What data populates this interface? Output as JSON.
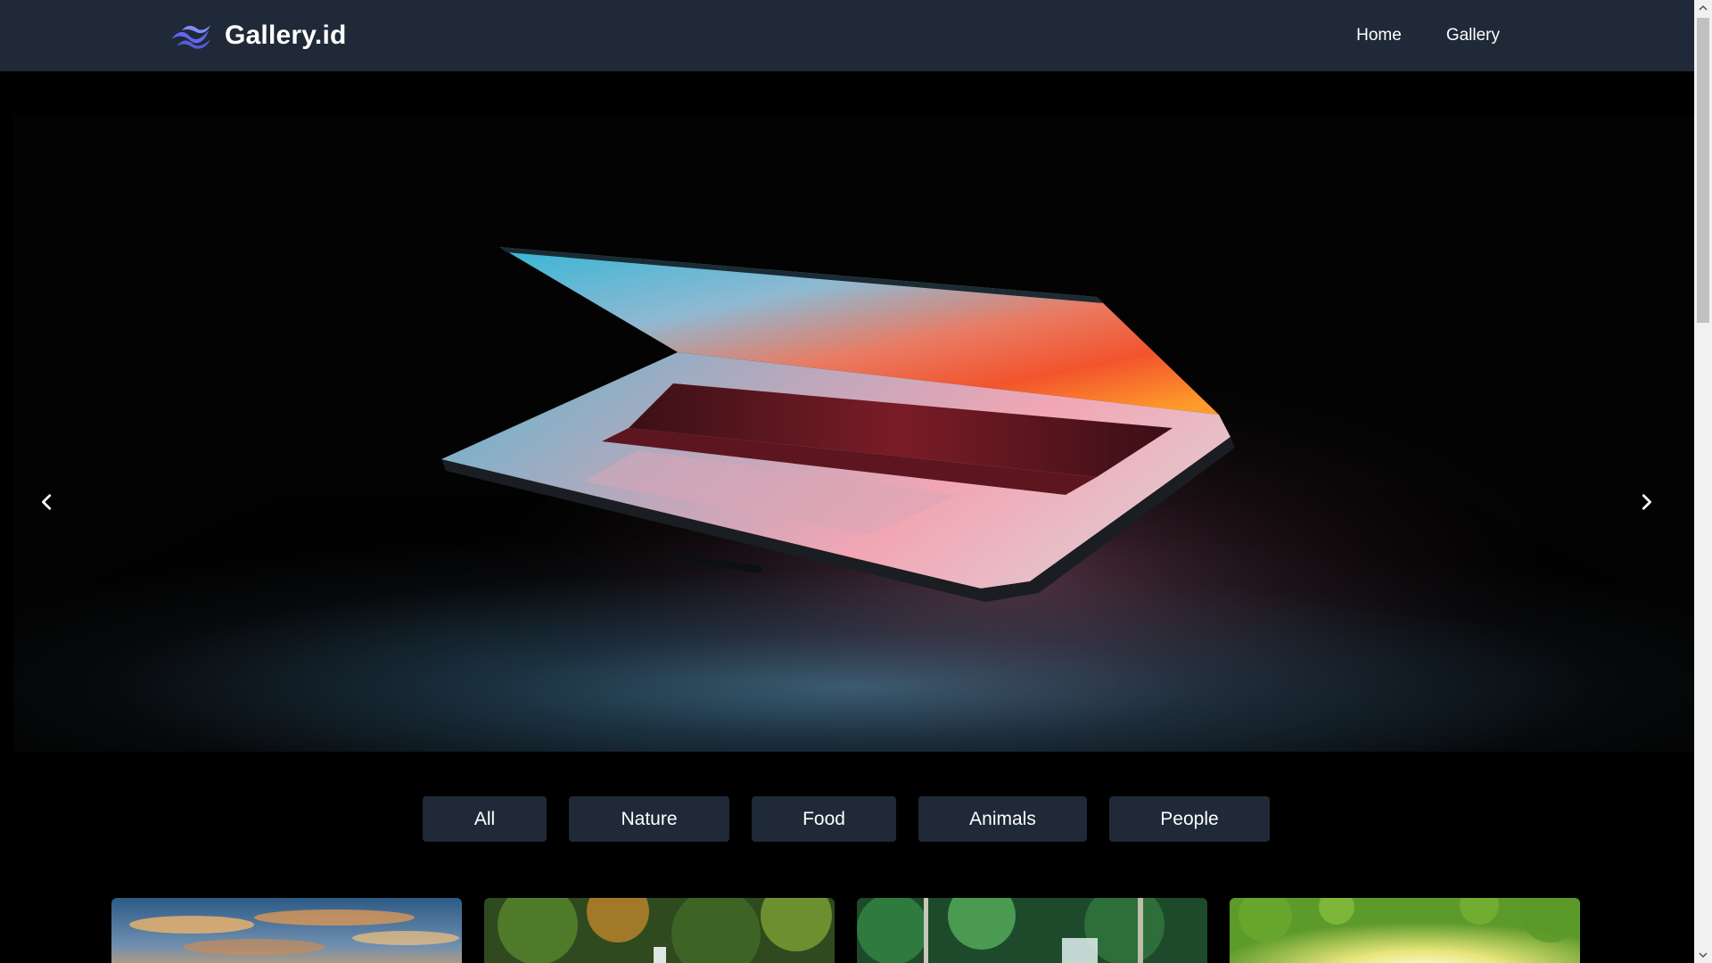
{
  "brand": {
    "name": "Gallery.id",
    "logo_icon": "wave-logo-icon",
    "logo_color": "#6366f1"
  },
  "nav": {
    "links": [
      {
        "label": "Home"
      },
      {
        "label": "Gallery"
      }
    ]
  },
  "hero": {
    "image": "laptop-photo",
    "prev_icon": "chevron-left-icon",
    "next_icon": "chevron-right-icon"
  },
  "filters": [
    {
      "label": "All"
    },
    {
      "label": "Nature"
    },
    {
      "label": "Food"
    },
    {
      "label": "Animals"
    },
    {
      "label": "People"
    }
  ],
  "gallery": {
    "items": [
      {
        "image": "sunset-sky-photo"
      },
      {
        "image": "forest-waterfall-photo"
      },
      {
        "image": "jungle-waterfall-photo"
      },
      {
        "image": "sunlit-leaves-photo"
      }
    ]
  },
  "colors": {
    "navbar_bg": "#1f2937",
    "button_bg": "#1f2937",
    "page_bg": "#000000",
    "text": "#ffffff"
  }
}
